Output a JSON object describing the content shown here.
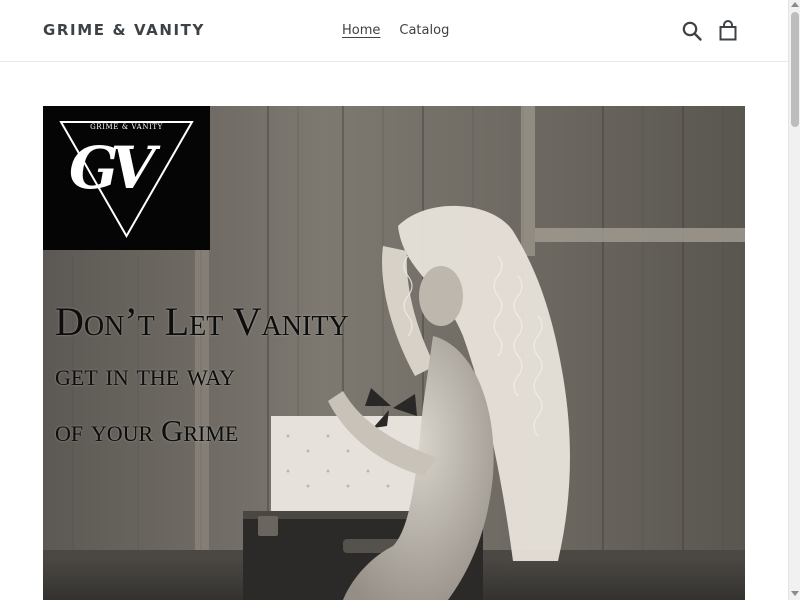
{
  "header": {
    "logo_text": "GRIME & VANITY",
    "nav": [
      {
        "label": "Home",
        "active": true
      },
      {
        "label": "Catalog",
        "active": false
      }
    ],
    "icons": [
      "search-icon",
      "cart-icon"
    ]
  },
  "hero": {
    "badge": {
      "small_text": "GRIME & VANITY",
      "letters": "GV"
    },
    "tagline": {
      "line1": "Don’t Let Vanity",
      "line2": "get in the way",
      "line3": "of your Grime"
    }
  }
}
